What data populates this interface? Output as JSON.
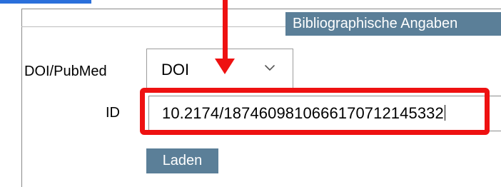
{
  "section": {
    "header": "Bibliographische Angaben"
  },
  "form": {
    "source_type_label": "DOI/PubMed",
    "source_type_selected": "DOI",
    "id_label": "ID",
    "id_value": "10.2174/1874609810666170712145332",
    "load_button_label": "Laden"
  },
  "icons": {
    "select_toggle": "chevron-down-icon",
    "annotation_arrow": "arrow-down-icon"
  },
  "colors": {
    "header_bg": "#5b7f98",
    "button_bg": "#5b7f98",
    "highlight": "#ee1111",
    "accent": "#2a6fdb"
  }
}
